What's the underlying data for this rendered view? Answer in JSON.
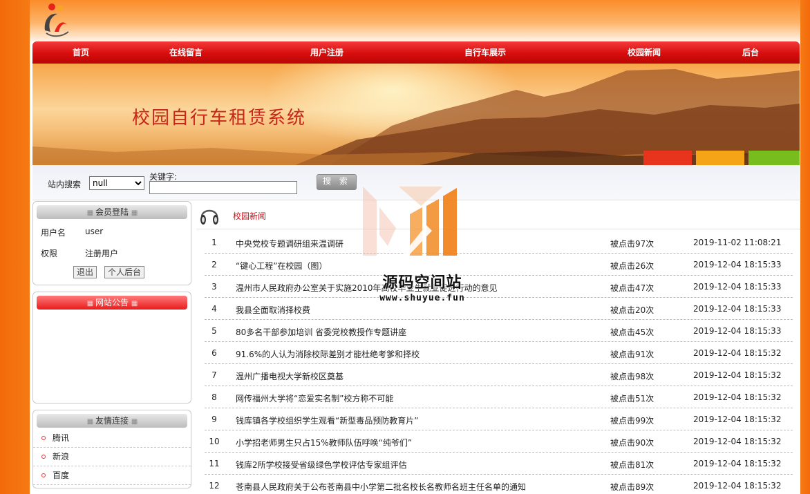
{
  "nav": [
    "首页",
    "在线留言",
    "用户注册",
    "自行车展示",
    "校园新闻",
    "后台"
  ],
  "banner": {
    "title": "校园自行车租赁系统"
  },
  "search": {
    "label": "站内搜索",
    "select_value": "null",
    "keyword_label": "关键字:",
    "keyword_value": "",
    "button": "搜 索"
  },
  "login_panel": {
    "title": "会员登陆",
    "username_label": "用户名",
    "username": "user",
    "role_label": "权限",
    "role": "注册用户",
    "logout_button": "退出",
    "backend_button": "个人后台"
  },
  "notice_panel": {
    "title": "网站公告"
  },
  "links_panel": {
    "title": "友情连接",
    "items": [
      "腾讯",
      "新浪",
      "百度"
    ]
  },
  "news": {
    "title": "校园新闻",
    "rows": [
      {
        "idx": "1",
        "title": "中央党校专题调研组来温调研",
        "clicks": "被点击97次",
        "date": "2019-11-02 11:08:21"
      },
      {
        "idx": "2",
        "title": "“键心工程”在校园（图）",
        "clicks": "被点击26次",
        "date": "2019-12-04 18:15:33"
      },
      {
        "idx": "3",
        "title": "温州市人民政府办公室关于实施2010年高校毕业生就业促进行动的意见",
        "clicks": "被点击47次",
        "date": "2019-12-04 18:15:33"
      },
      {
        "idx": "4",
        "title": "我县全面取消择校费",
        "clicks": "被点击20次",
        "date": "2019-12-04 18:15:33"
      },
      {
        "idx": "5",
        "title": "80多名干部参加培训 省委党校教授作专题讲座",
        "clicks": "被点击45次",
        "date": "2019-12-04 18:15:33"
      },
      {
        "idx": "6",
        "title": "91.6%的人认为消除校际差别才能杜绝考爹和择校",
        "clicks": "被点击91次",
        "date": "2019-12-04 18:15:32"
      },
      {
        "idx": "7",
        "title": "温州广播电视大学新校区奠基",
        "clicks": "被点击98次",
        "date": "2019-12-04 18:15:32"
      },
      {
        "idx": "8",
        "title": "网传福州大学将“恋爱实名制”校方称不可能",
        "clicks": "被点击51次",
        "date": "2019-12-04 18:15:32"
      },
      {
        "idx": "9",
        "title": "钱库镇各学校组织学生观看“新型毒品预防教育片”",
        "clicks": "被点击99次",
        "date": "2019-12-04 18:15:32"
      },
      {
        "idx": "10",
        "title": "小学招老师男生只占15%教师队伍呼唤“纯爷们”",
        "clicks": "被点击90次",
        "date": "2019-12-04 18:15:32"
      },
      {
        "idx": "11",
        "title": "钱库2所学校接受省级绿色学校评估专家组评估",
        "clicks": "被点击81次",
        "date": "2019-12-04 18:15:32"
      },
      {
        "idx": "12",
        "title": "苍南县人民政府关于公布苍南县中小学第二批名校长名教师名班主任名单的通知",
        "clicks": "被点击89次",
        "date": "2019-12-04 18:15:32"
      }
    ]
  },
  "watermark": {
    "name": "源码空间站",
    "url": "www.shuyue.fun"
  },
  "colors": {
    "nav_red": "#d80d0d",
    "page_orange": "#f57a14",
    "news_title_red": "#c8101a"
  }
}
